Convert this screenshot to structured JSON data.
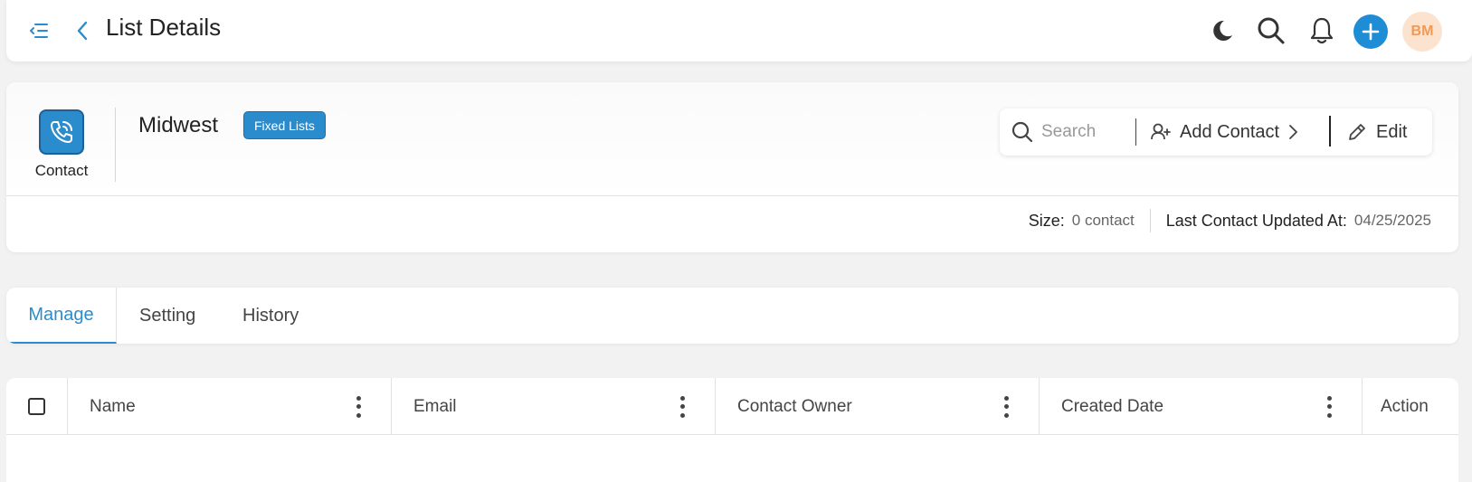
{
  "header": {
    "title": "List Details",
    "user_initials": "BM"
  },
  "list": {
    "type_label": "Contact",
    "name": "Midwest",
    "badge": "Fixed Lists",
    "search_placeholder": "Search",
    "add_contact_label": "Add Contact",
    "edit_label": "Edit"
  },
  "meta": {
    "size_label": "Size:",
    "size_value": "0 contact",
    "updated_label": "Last Contact Updated At:",
    "updated_value": "04/25/2025"
  },
  "tabs": [
    {
      "label": "Manage",
      "active": true
    },
    {
      "label": "Setting",
      "active": false
    },
    {
      "label": "History",
      "active": false
    }
  ],
  "table": {
    "columns": [
      "Name",
      "Email",
      "Contact Owner",
      "Created Date",
      "Action"
    ],
    "rows": []
  },
  "colors": {
    "accent": "#2b8ccd",
    "plus_button": "#1f8dd6",
    "avatar_bg": "#fbe3d0",
    "avatar_text": "#f29a55"
  },
  "icons": [
    "menu-collapse-icon",
    "back-arrow-icon",
    "moon-icon",
    "search-icon",
    "bell-icon",
    "plus-icon",
    "phone-icon",
    "add-user-icon",
    "chevron-right-icon",
    "pencil-icon",
    "kebab-icon"
  ]
}
